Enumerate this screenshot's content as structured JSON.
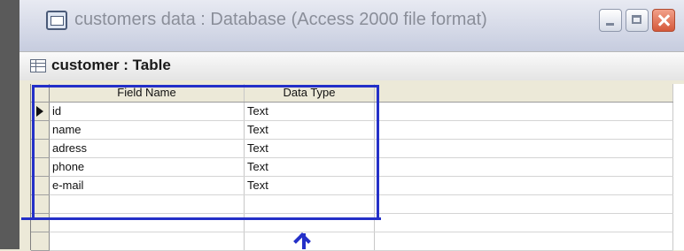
{
  "database_window": {
    "title": "customers data : Database (Access 2000 file format)",
    "icon": "database-icon"
  },
  "table_window": {
    "title": "customer : Table",
    "icon": "table-icon"
  },
  "design_grid": {
    "columns": [
      "Field Name",
      "Data Type",
      ""
    ],
    "rows": [
      {
        "field_name": "id",
        "data_type": "Text",
        "current": true
      },
      {
        "field_name": "name",
        "data_type": "Text",
        "current": false
      },
      {
        "field_name": "adress",
        "data_type": "Text",
        "current": false
      },
      {
        "field_name": "phone",
        "data_type": "Text",
        "current": false
      },
      {
        "field_name": "e-mail",
        "data_type": "Text",
        "current": false
      },
      {
        "field_name": "",
        "data_type": "",
        "current": false
      },
      {
        "field_name": "",
        "data_type": "",
        "current": false
      },
      {
        "field_name": "",
        "data_type": "",
        "current": false
      }
    ]
  },
  "annotation": {
    "color": "#2430c8"
  }
}
